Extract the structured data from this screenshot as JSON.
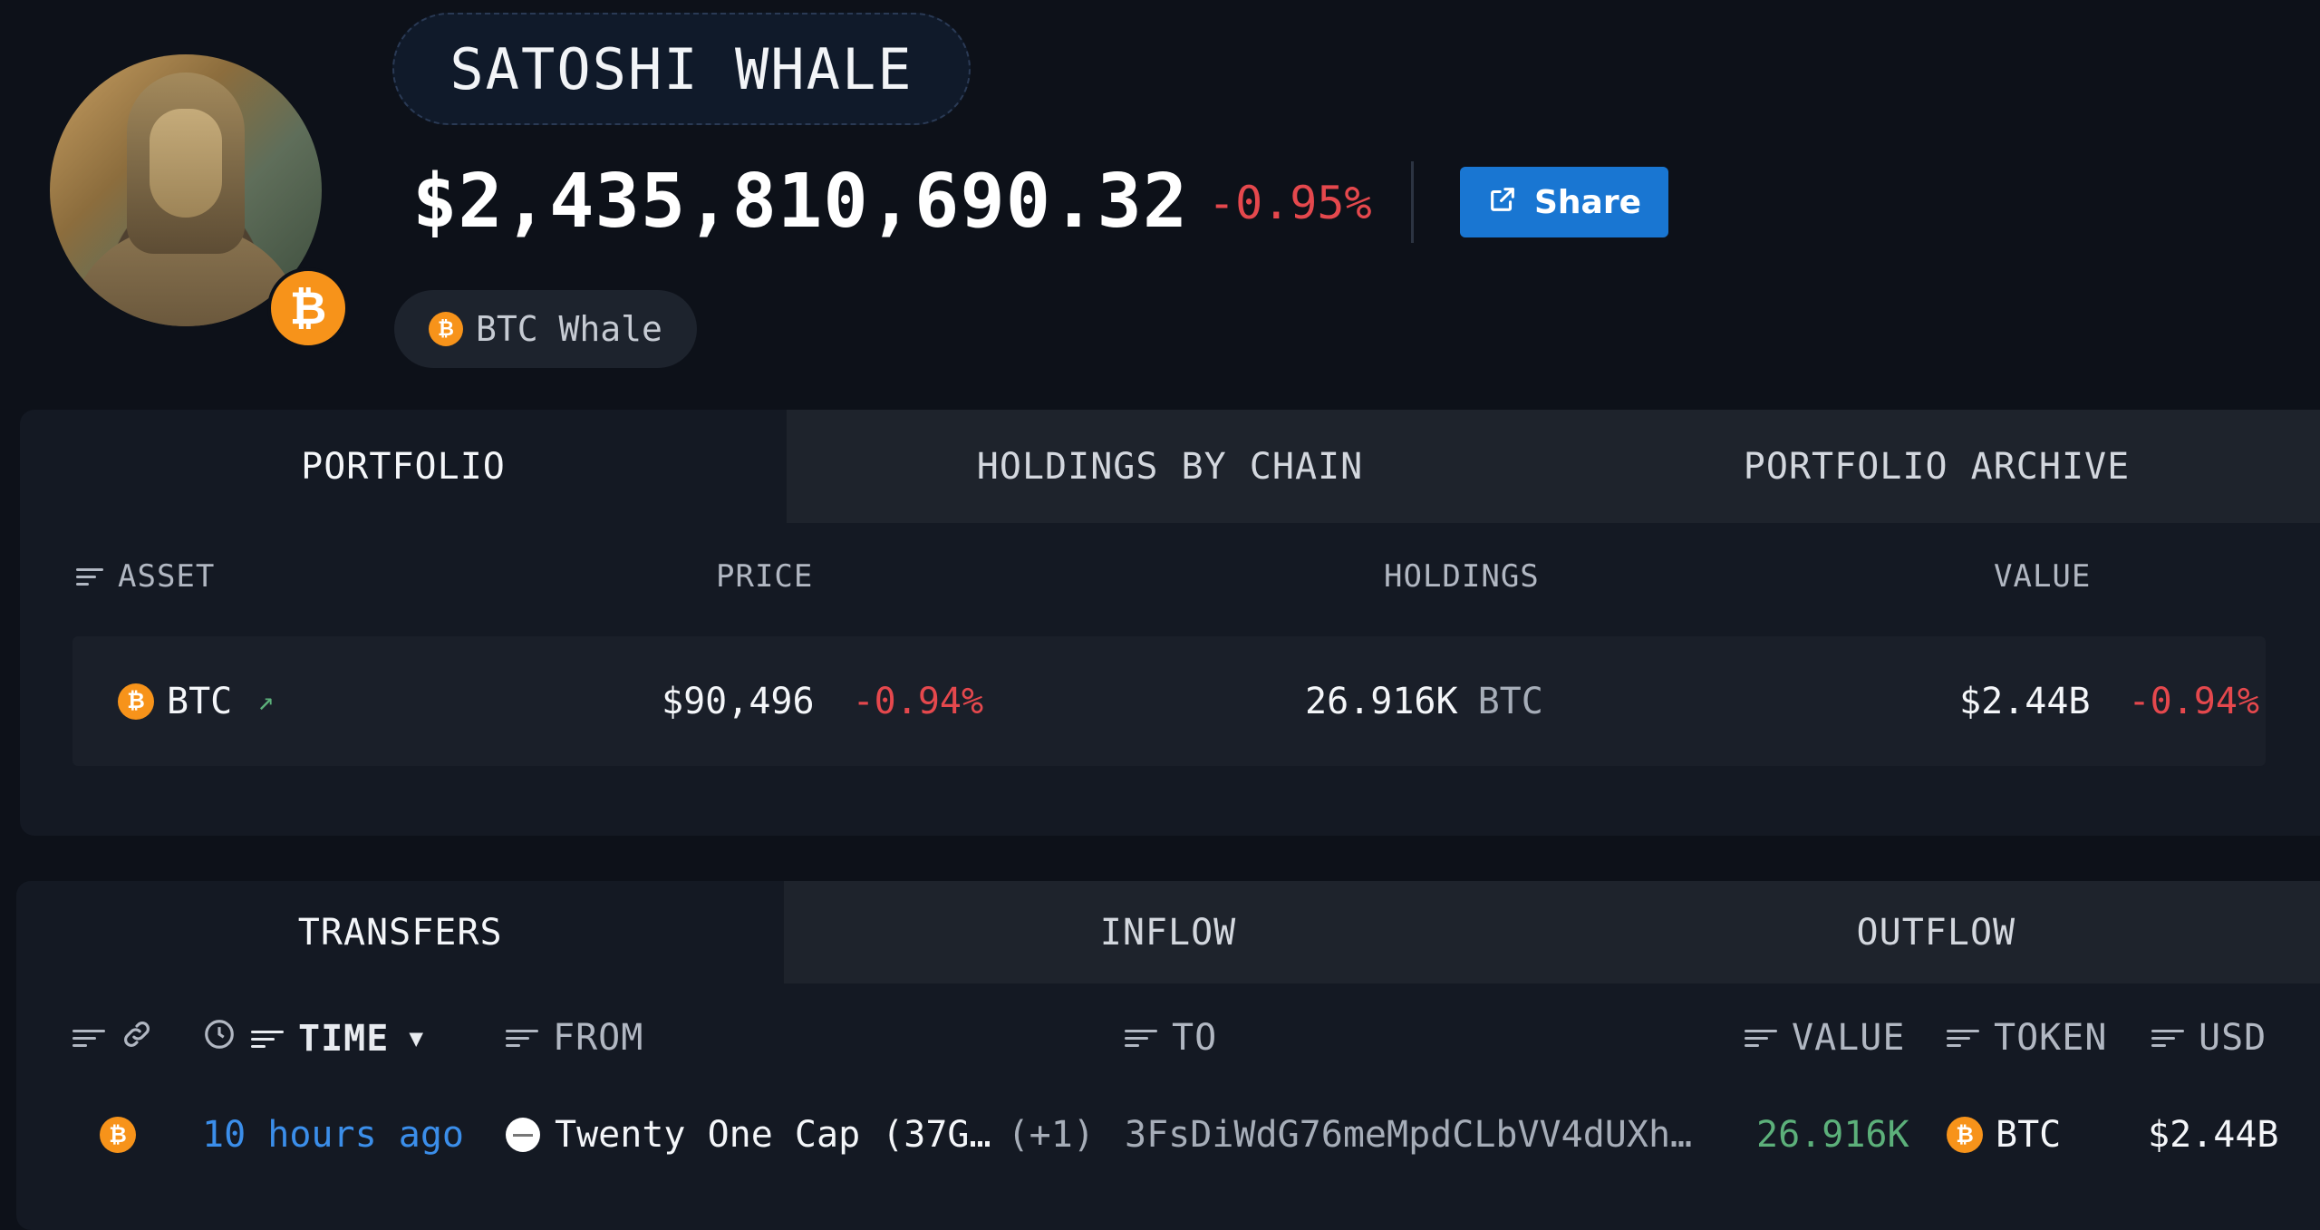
{
  "profile": {
    "name": "SATOSHI WHALE",
    "balance": "$2,435,810,690.32",
    "balance_change": "-0.95%",
    "share_label": "Share",
    "tag_label": "BTC Whale",
    "avatar_badge_symbol": "₿"
  },
  "portfolio_tabs": [
    "PORTFOLIO",
    "HOLDINGS BY CHAIN",
    "PORTFOLIO ARCHIVE"
  ],
  "portfolio_columns": {
    "asset": "ASSET",
    "price": "PRICE",
    "holdings": "HOLDINGS",
    "value": "VALUE"
  },
  "portfolio_rows": [
    {
      "symbol": "BTC",
      "trend_icon": "↗",
      "price": "$90,496",
      "price_change": "-0.94%",
      "holdings": "26.916K",
      "holdings_unit": "BTC",
      "value": "$2.44B",
      "value_change": "-0.94%"
    }
  ],
  "transfer_tabs": [
    "TRANSFERS",
    "INFLOW",
    "OUTFLOW"
  ],
  "transfer_columns": {
    "time": "TIME",
    "from": "FROM",
    "to": "TO",
    "value": "VALUE",
    "token": "TOKEN",
    "usd": "USD"
  },
  "transfer_rows": [
    {
      "time": "10 hours ago",
      "from": "Twenty One Cap",
      "from_addr": "(37G…",
      "from_extra": "(+1)",
      "to": "3FsDiWdG76meMpdCLbVV4dUXh…",
      "value": "26.916K",
      "token": "BTC",
      "usd": "$2.44B"
    }
  ],
  "colors": {
    "background": "#0d1119",
    "accent": "#1976d2",
    "negative": "#e5484d",
    "positive": "#5cb07a",
    "link": "#3b8eea",
    "btc": "#f7931a"
  },
  "icons": {
    "filter": "filter-icon",
    "link": "link-icon",
    "clock": "clock-icon",
    "sort_desc": "caret-down-icon",
    "share": "external-link-icon"
  }
}
